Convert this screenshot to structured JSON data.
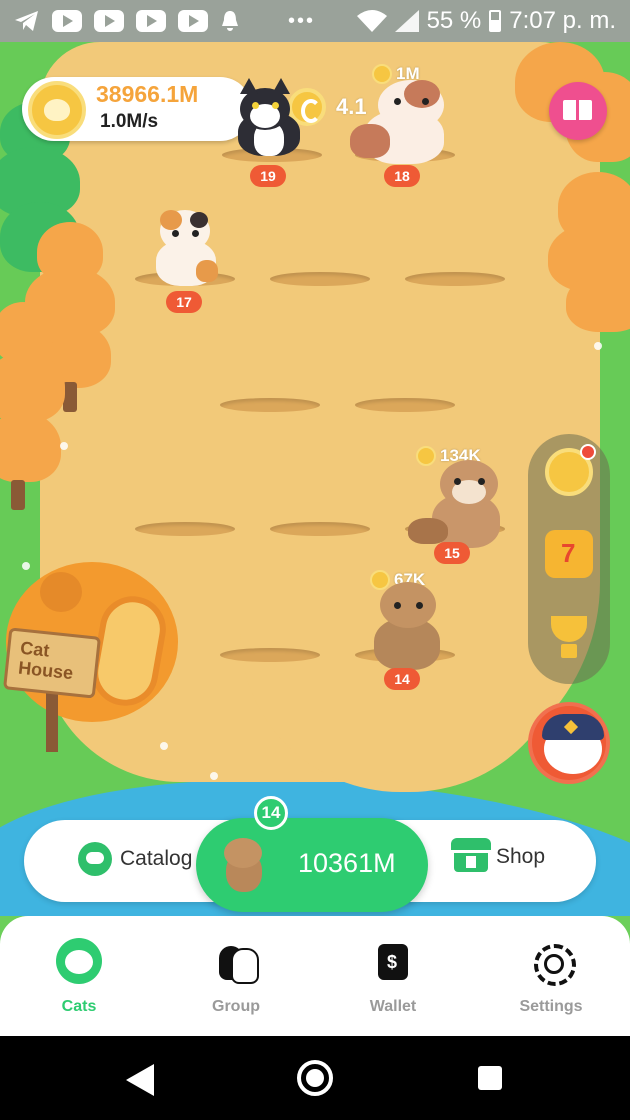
{
  "status_bar": {
    "battery": "55 %",
    "time": "7:07 p. m."
  },
  "game": {
    "coins": {
      "total": "38966.1M",
      "rate": "1.0M/s"
    },
    "floating_earning": "4.1",
    "cats": [
      {
        "level": "19",
        "earning": ""
      },
      {
        "level": "18",
        "earning": "1M"
      },
      {
        "level": "17",
        "earning": ""
      },
      {
        "level": "15",
        "earning": "134K"
      },
      {
        "level": "14",
        "earning": "67K"
      }
    ],
    "house_sign": [
      "Cat",
      "House"
    ]
  },
  "action_bar": {
    "catalog_label": "Catalog",
    "buy_level": "14",
    "buy_price": "10361M",
    "shop_label": "Shop"
  },
  "bottom_nav": {
    "items": [
      {
        "label": "Cats",
        "icon": "cat-face-icon",
        "active": true
      },
      {
        "label": "Group",
        "icon": "group-cats-icon",
        "active": false
      },
      {
        "label": "Wallet",
        "icon": "wallet-icon",
        "active": false
      },
      {
        "label": "Settings",
        "icon": "gear-icon",
        "active": false
      }
    ]
  },
  "colors": {
    "accent_green": "#2ecc71",
    "coin_gold": "#f6c642",
    "level_badge": "#ef5a35",
    "sand": "#f2c979",
    "grass": "#67cb57"
  }
}
